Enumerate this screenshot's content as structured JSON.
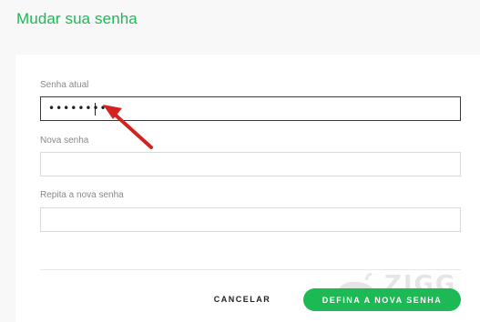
{
  "page": {
    "title": "Mudar sua senha"
  },
  "form": {
    "current_password": {
      "label": "Senha atual",
      "value": "••••••••"
    },
    "new_password": {
      "label": "Nova senha",
      "value": ""
    },
    "repeat_password": {
      "label": "Repita a nova senha",
      "value": ""
    }
  },
  "actions": {
    "cancel_label": "CANCELAR",
    "submit_label": "DEFINA A NOVA SENHA"
  },
  "watermark": {
    "text": "ZIGG"
  },
  "colors": {
    "accent": "#1db954",
    "annotation_arrow": "#d32222"
  },
  "annotation": {
    "icon": "red-arrow-icon"
  }
}
